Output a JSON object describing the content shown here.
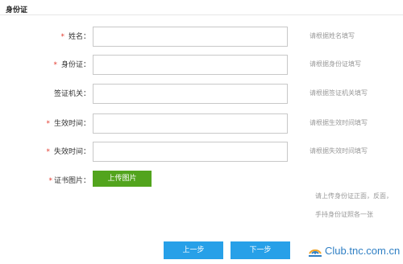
{
  "section": {
    "title": "身份证"
  },
  "required_mark": "*",
  "form": {
    "name": {
      "label": "姓名：",
      "value": "",
      "hint": "请根据姓名填写"
    },
    "id_number": {
      "label": "身份证：",
      "value": "",
      "hint": "请根据身份证填写"
    },
    "issuing_authority": {
      "label": "签证机关：",
      "value": "",
      "hint": "请根据签证机关填写"
    },
    "effective_time": {
      "label": "生效时间：",
      "value": "",
      "hint": "请根据生效时间填写"
    },
    "expiry_time": {
      "label": "失效时间：",
      "value": "",
      "hint": "请根据失效时间填写"
    },
    "certificate_image": {
      "label": "证书图片：",
      "button": "上传图片"
    }
  },
  "upload_notes": [
    "请上传身份证正面，反面，",
    "手持身份证照各一张"
  ],
  "buttons": {
    "prev": "上一步",
    "next": "下一步"
  },
  "watermark": {
    "text": "Club.tnc.com.cn"
  },
  "colors": {
    "required": "#e23a2e",
    "upload_button": "#52a41d",
    "nav_button": "#27a0e8",
    "watermark": "#2f7fc4"
  }
}
